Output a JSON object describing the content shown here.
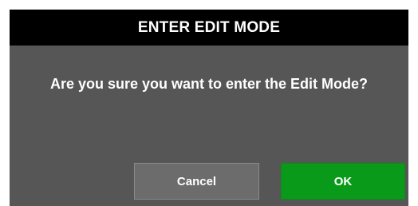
{
  "dialog": {
    "title": "ENTER EDIT MODE",
    "message": "Are you sure you want to enter the Edit Mode?",
    "buttons": {
      "cancel_label": "Cancel",
      "ok_label": "OK"
    }
  },
  "colors": {
    "titlebar_bg": "#000000",
    "body_bg": "#565656",
    "cancel_bg": "#6c6c6c",
    "ok_bg": "#0a9a1a",
    "text": "#ffffff"
  }
}
